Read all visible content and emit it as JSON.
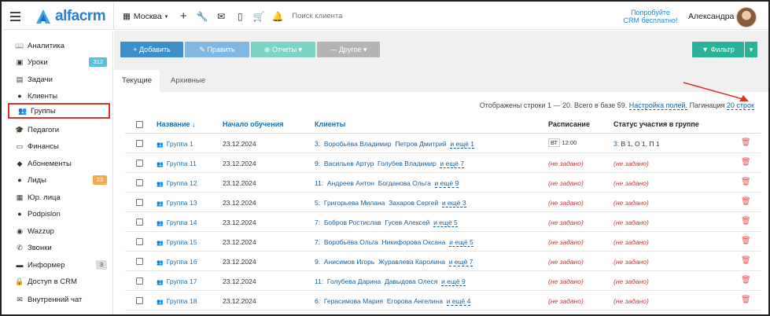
{
  "topbar": {
    "logo_text": "alfacrm",
    "branch": "Москва",
    "search_placeholder": "Поиск клиента",
    "promo_line1": "Попробуйте",
    "promo_line2": "CRM бесплатно!",
    "user_name": "Александра",
    "icons": [
      "menu-icon",
      "building-icon",
      "plus-icon",
      "wrench-icon",
      "mail-icon",
      "phone-icon",
      "cart-icon",
      "bell-icon"
    ],
    "accent": "#2a7fd0"
  },
  "sidebar": {
    "items": [
      {
        "label": "Аналитика",
        "icon": "book-icon"
      },
      {
        "label": "Уроки",
        "icon": "calendar-icon",
        "badge": "312",
        "badge_color": "#5bc0de"
      },
      {
        "label": "Задачи",
        "icon": "clipboard-icon"
      },
      {
        "label": "Клиенты",
        "icon": "user-icon"
      },
      {
        "label": "Группы",
        "icon": "users-icon",
        "active": true
      },
      {
        "label": "Педагоги",
        "icon": "graduation-cap-icon"
      },
      {
        "label": "Финансы",
        "icon": "money-icon"
      },
      {
        "label": "Абонементы",
        "icon": "tag-icon"
      },
      {
        "label": "Лиды",
        "icon": "user-plus-icon",
        "badge": "23",
        "badge_color": "#f0ad4e"
      },
      {
        "label": "Юр. лица",
        "icon": "id-card-icon"
      },
      {
        "label": "Podpislon",
        "icon": "circle-icon"
      },
      {
        "label": "Wazzup",
        "icon": "whatsapp-icon"
      },
      {
        "label": "Звонки",
        "icon": "phone-icon"
      },
      {
        "label": "Информер",
        "icon": "comment-icon",
        "badge": "3",
        "badge_color": "#dddddd"
      },
      {
        "label": "Доступ в CRM",
        "icon": "lock-icon"
      },
      {
        "label": "Внутренний чат",
        "icon": "envelope-icon"
      }
    ]
  },
  "toolbar": {
    "add": "+ Добавить",
    "edit": "✎ Править",
    "reports": "⊕ Отчеты ▾",
    "other": "— Другое ▾",
    "filter": "▼ Фильтр",
    "filter_caret": "▾"
  },
  "tabs": {
    "current": "Текущие",
    "archive": "Архивные"
  },
  "info": {
    "rows_text": "Отображены строки 1 — 20. Всего в базе 59.",
    "settings_link": "Настройка полей.",
    "pagination_label": "Пагинация",
    "pagination_value": "20 строк"
  },
  "table": {
    "headers": {
      "name": "Название ↓",
      "start": "Начало обучения",
      "clients": "Клиенты",
      "schedule": "Расписание",
      "status": "Статус участия в группе"
    },
    "rows": [
      {
        "name": "Группа 1",
        "date": "23.12.2024",
        "count": "3:",
        "c1": "Воробьёва Владимир",
        "c2": "Петров Дмитрий",
        "more": "и ещё 1",
        "sched_day": "ВТ",
        "sched_time": "12:00",
        "status_count": "3:",
        "status": "В 1, О 1, П 1"
      },
      {
        "name": "Группа 11",
        "date": "23.12.2024",
        "count": "9:",
        "c1": "Васильев Артур",
        "c2": "Голубев Владимир",
        "more": "и ещё 7",
        "sched": "(не задано)",
        "status": "(не задано)"
      },
      {
        "name": "Группа 12",
        "date": "23.12.2024",
        "count": "11:",
        "c1": "Андреев Антон",
        "c2": "Богданова Ольга",
        "more": "и ещё 9",
        "sched": "(не задано)",
        "status": "(не задано)"
      },
      {
        "name": "Группа 13",
        "date": "23.12.2024",
        "count": "5:",
        "c1": "Григорьева Милана",
        "c2": "Захаров Сергей",
        "more": "и ещё 3",
        "sched": "(не задано)",
        "status": "(не задано)"
      },
      {
        "name": "Группа 14",
        "date": "23.12.2024",
        "count": "7:",
        "c1": "Бобров Ростислав",
        "c2": "Гусев Алексей",
        "more": "и ещё 5",
        "sched": "(не задано)",
        "status": "(не задано)"
      },
      {
        "name": "Группа 15",
        "date": "23.12.2024",
        "count": "7:",
        "c1": "Воробьёва Ольга",
        "c2": "Никифорова Оксана",
        "more": "и ещё 5",
        "sched": "(не задано)",
        "status": "(не задано)"
      },
      {
        "name": "Группа 16",
        "date": "23.12.2024",
        "count": "9:",
        "c1": "Анисимов Игорь",
        "c2": "Журавлева Каролина",
        "more": "и ещё 7",
        "sched": "(не задано)",
        "status": "(не задано)"
      },
      {
        "name": "Группа 17",
        "date": "23.12.2024",
        "count": "11:",
        "c1": "Голубева Дарина",
        "c2": "Давыдова Олеся",
        "more": "и ещё 9",
        "sched": "(не задано)",
        "status": "(не задано)"
      },
      {
        "name": "Группа 18",
        "date": "23.12.2024",
        "count": "6:",
        "c1": "Герасимова Мария",
        "c2": "Егорова Ангелина",
        "more": "и ещё 4",
        "sched": "(не задано)",
        "status": "(не задано)"
      }
    ]
  }
}
